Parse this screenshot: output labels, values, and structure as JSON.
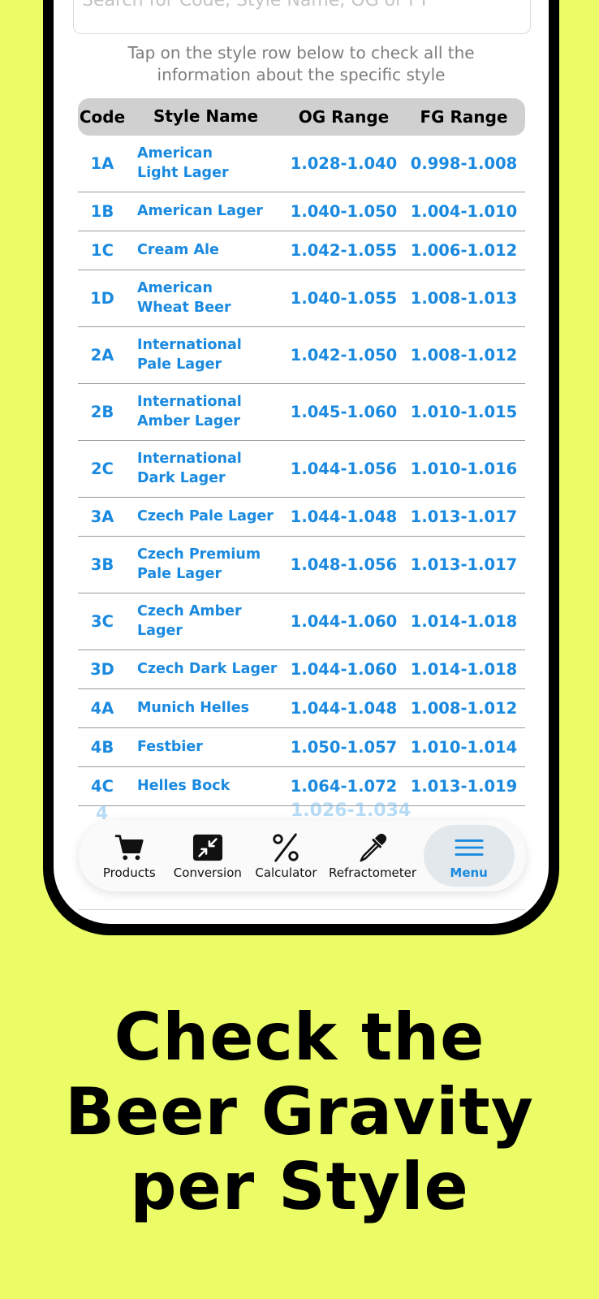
{
  "search": {
    "placeholder": "Search for Code, Style Name, OG or FT"
  },
  "hint": [
    "Tap on the style row below to check all the",
    "information about the specific style"
  ],
  "table": {
    "headers": {
      "code": "Code",
      "name": "Style Name",
      "og": "OG Range",
      "fg": "FG Range"
    },
    "rows": [
      {
        "code": "1A",
        "name": [
          "American",
          "Light Lager"
        ],
        "og": "1.028-1.040",
        "fg": "0.998-1.008"
      },
      {
        "code": "1B",
        "name": [
          "American Lager"
        ],
        "og": "1.040-1.050",
        "fg": "1.004-1.010"
      },
      {
        "code": "1C",
        "name": [
          "Cream Ale"
        ],
        "og": "1.042-1.055",
        "fg": "1.006-1.012"
      },
      {
        "code": "1D",
        "name": [
          "American",
          "Wheat Beer"
        ],
        "og": "1.040-1.055",
        "fg": "1.008-1.013"
      },
      {
        "code": "2A",
        "name": [
          "International",
          "Pale Lager"
        ],
        "og": "1.042-1.050",
        "fg": "1.008-1.012"
      },
      {
        "code": "2B",
        "name": [
          "International",
          "Amber Lager"
        ],
        "og": "1.045-1.060",
        "fg": "1.010-1.015"
      },
      {
        "code": "2C",
        "name": [
          "International",
          "Dark Lager"
        ],
        "og": "1.044-1.056",
        "fg": "1.010-1.016"
      },
      {
        "code": "3A",
        "name": [
          "Czech Pale Lager"
        ],
        "og": "1.044-1.048",
        "fg": "1.013-1.017"
      },
      {
        "code": "3B",
        "name": [
          "Czech Premium",
          "Pale Lager"
        ],
        "og": "1.048-1.056",
        "fg": "1.013-1.017"
      },
      {
        "code": "3C",
        "name": [
          "Czech Amber",
          "Lager"
        ],
        "og": "1.044-1.060",
        "fg": "1.014-1.018"
      },
      {
        "code": "3D",
        "name": [
          "Czech Dark Lager"
        ],
        "og": "1.044-1.060",
        "fg": "1.014-1.018"
      },
      {
        "code": "4A",
        "name": [
          "Munich Helles"
        ],
        "og": "1.044-1.048",
        "fg": "1.008-1.012"
      },
      {
        "code": "4B",
        "name": [
          "Festbier"
        ],
        "og": "1.050-1.057",
        "fg": "1.010-1.014"
      },
      {
        "code": "4C",
        "name": [
          "Helles Bock"
        ],
        "og": "1.064-1.072",
        "fg": "1.013-1.019"
      }
    ],
    "partial_row": {
      "code": "4",
      "og": "1.026-1.034"
    }
  },
  "tabs": [
    {
      "id": "products",
      "label": "Products",
      "icon": "cart-icon"
    },
    {
      "id": "conversion",
      "label": "Conversion",
      "icon": "compress-arrows-icon"
    },
    {
      "id": "calculator",
      "label": "Calculator",
      "icon": "percent-icon"
    },
    {
      "id": "refractometer",
      "label": "Refractometer",
      "icon": "dropper-icon"
    },
    {
      "id": "menu",
      "label": "Menu",
      "icon": "hamburger-menu-icon",
      "active": true
    }
  ],
  "headline": [
    "Check the",
    "Beer Gravity",
    "per Style"
  ],
  "colors": {
    "background": "#ebfc66",
    "accent": "#1a8ae0",
    "header_bg": "#d0d0d0"
  }
}
